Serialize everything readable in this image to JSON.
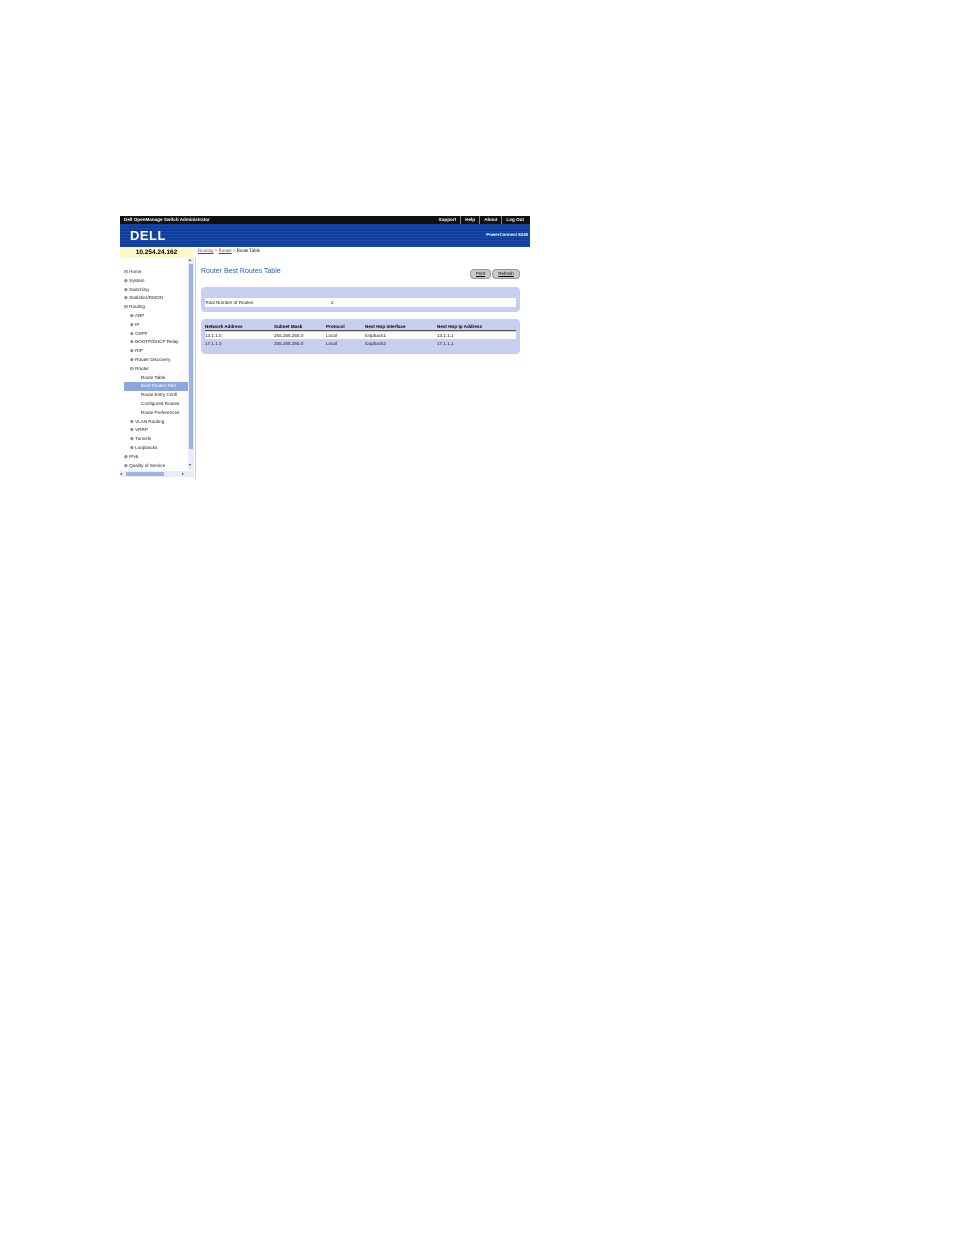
{
  "header": {
    "app_title": "Dell OpenManage Switch Administrator",
    "nav": [
      "Support",
      "Help",
      "About",
      "Log Out"
    ],
    "logo": "DELL",
    "model": "PowerConnect 6248"
  },
  "device_ip": "10.254.24.162",
  "breadcrumb": {
    "items": [
      "Routing",
      "Router"
    ],
    "separator": ">",
    "current": "Route Table"
  },
  "sidebar": {
    "items": [
      {
        "label": "Home",
        "prefix": "⊟"
      },
      {
        "label": "System",
        "prefix": "⊕"
      },
      {
        "label": "Switching",
        "prefix": "⊕"
      },
      {
        "label": "Statistics/RMON",
        "prefix": "⊕"
      },
      {
        "label": "Routing",
        "prefix": "⊟"
      },
      {
        "label": "ARP",
        "prefix": "⊕"
      },
      {
        "label": "IP",
        "prefix": "⊕"
      },
      {
        "label": "OSPF",
        "prefix": "⊕"
      },
      {
        "label": "BOOTP/DHCP Relay",
        "prefix": "⊕"
      },
      {
        "label": "RIP",
        "prefix": "⊕"
      },
      {
        "label": "Router Discovery",
        "prefix": "⊕"
      },
      {
        "label": "Router",
        "prefix": "⊟"
      },
      {
        "label": "Route Table",
        "prefix": ""
      },
      {
        "label": "Best Routes Tabl",
        "prefix": ""
      },
      {
        "label": "Route Entry Confi",
        "prefix": ""
      },
      {
        "label": "Configured Routes",
        "prefix": ""
      },
      {
        "label": "Route Preferences",
        "prefix": ""
      },
      {
        "label": "VLAN Routing",
        "prefix": "⊕"
      },
      {
        "label": "VRRP",
        "prefix": "⊕"
      },
      {
        "label": "Tunnels",
        "prefix": "⊕"
      },
      {
        "label": "Loopbacks",
        "prefix": "⊕"
      },
      {
        "label": "IPv6",
        "prefix": "⊕"
      },
      {
        "label": "Quality of Service",
        "prefix": "⊕"
      }
    ],
    "selected_index": 13
  },
  "page": {
    "title": "Router Best Routes Table",
    "print_label": "Print",
    "refresh_label": "Refresh"
  },
  "summary": {
    "label": "Total Number of Routes",
    "value": "2"
  },
  "table": {
    "columns": [
      "Network Address",
      "Subnet Mask",
      "Protocol",
      "Next Hop Interface",
      "Next Hop Ip Address"
    ],
    "rows": [
      [
        "13.1.1.0",
        "255.255.255.0",
        "Local",
        "loopback1",
        "13.1.1.1"
      ],
      [
        "17.1.1.0",
        "255.255.255.0",
        "Local",
        "loopback2",
        "17.1.1.1"
      ]
    ]
  },
  "colors": {
    "banner": "#0f3f9e",
    "panel": "#c7cff0",
    "title": "#2a5bbd",
    "selection": "#8aa7e0",
    "ip_bar": "#fff8c8"
  },
  "icons": {
    "expand": "plus-box-icon",
    "collapse": "minus-box-icon"
  }
}
